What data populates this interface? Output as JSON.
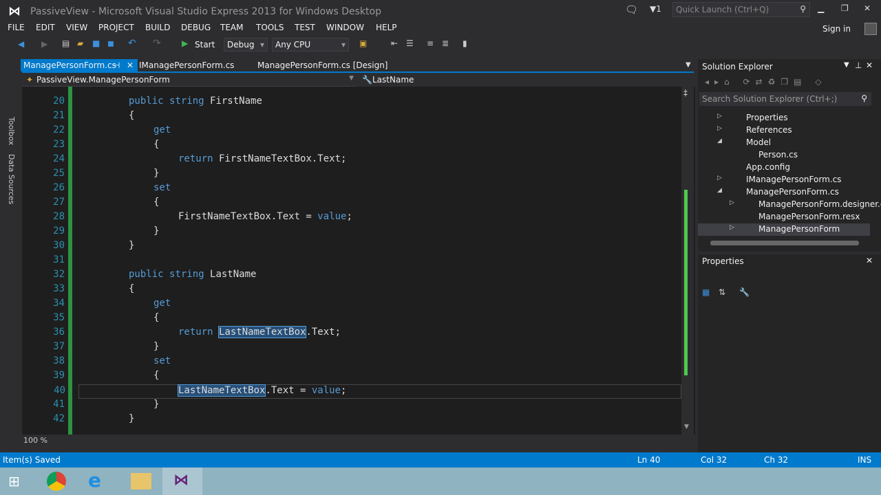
{
  "window": {
    "title": "PassiveView - Microsoft Visual Studio Express 2013 for Windows Desktop",
    "notification_count": "1",
    "quick_launch_placeholder": "Quick Launch (Ctrl+Q)",
    "sign_in": "Sign in"
  },
  "menu": [
    "FILE",
    "EDIT",
    "VIEW",
    "PROJECT",
    "BUILD",
    "DEBUG",
    "TEAM",
    "TOOLS",
    "TEST",
    "WINDOW",
    "HELP"
  ],
  "toolbar": {
    "start": "Start",
    "config": "Debug",
    "platform": "Any CPU"
  },
  "tabs": [
    "ManagePersonForm.cs",
    "IManagePersonForm.cs",
    "ManagePersonForm.cs [Design]"
  ],
  "nav": {
    "class": "PassiveView.ManagePersonForm",
    "member": "LastName"
  },
  "side_tabs": [
    "Toolbox",
    "Data Sources"
  ],
  "code": [
    {
      "n": "20",
      "t": "public string FirstName"
    },
    {
      "n": "21",
      "t": "{"
    },
    {
      "n": "22",
      "t": "get"
    },
    {
      "n": "23",
      "t": "{"
    },
    {
      "n": "24",
      "t": "return FirstNameTextBox.Text;"
    },
    {
      "n": "25",
      "t": "}"
    },
    {
      "n": "26",
      "t": "set"
    },
    {
      "n": "27",
      "t": "{"
    },
    {
      "n": "28",
      "t": "FirstNameTextBox.Text = value;"
    },
    {
      "n": "29",
      "t": "}"
    },
    {
      "n": "30",
      "t": "}"
    },
    {
      "n": "31",
      "t": ""
    },
    {
      "n": "32",
      "t": "public string LastName"
    },
    {
      "n": "33",
      "t": "{"
    },
    {
      "n": "34",
      "t": "get"
    },
    {
      "n": "35",
      "t": "{"
    },
    {
      "n": "36",
      "t": "return LastNameTextBox.Text;"
    },
    {
      "n": "37",
      "t": "}"
    },
    {
      "n": "38",
      "t": "set"
    },
    {
      "n": "39",
      "t": "{"
    },
    {
      "n": "40",
      "t": "LastNameTextBox.Text = value;"
    },
    {
      "n": "41",
      "t": "}"
    },
    {
      "n": "42",
      "t": "}"
    }
  ],
  "zoom": "100 %",
  "solution_explorer": {
    "title": "Solution Explorer",
    "search_placeholder": "Search Solution Explorer (Ctrl+;)",
    "items": [
      "Properties",
      "References",
      "Model",
      "Person.cs",
      "App.config",
      "IManagePersonForm.cs",
      "ManagePersonForm.cs",
      "ManagePersonForm.designer.cs",
      "ManagePersonForm.resx",
      "ManagePersonForm"
    ]
  },
  "properties": {
    "title": "Properties"
  },
  "status": {
    "message": "Item(s) Saved",
    "ln": "Ln 40",
    "col": "Col 32",
    "ch": "Ch 32",
    "mode": "INS"
  },
  "colors": {
    "accent": "#007acc",
    "keyword": "#569cd6"
  }
}
